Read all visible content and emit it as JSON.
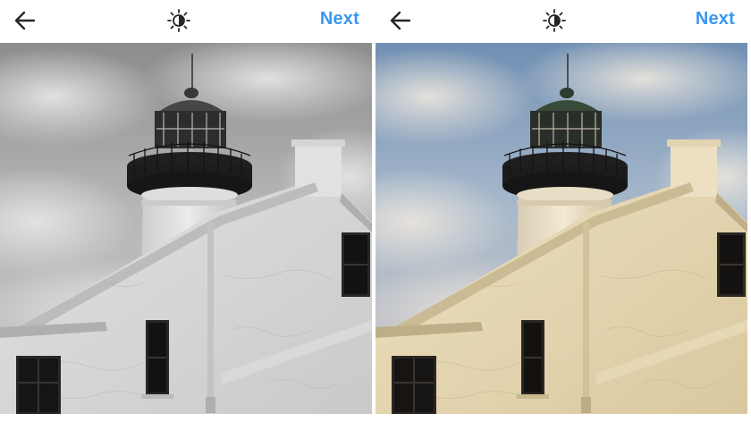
{
  "panels": [
    {
      "id": "left",
      "next_label": "Next",
      "filter": "black-and-white",
      "icons": {
        "back": "arrow-left-icon",
        "brightness": "brightness-icon"
      }
    },
    {
      "id": "right",
      "next_label": "Next",
      "filter": "warm-color",
      "icons": {
        "back": "arrow-left-icon",
        "brightness": "brightness-icon"
      }
    }
  ],
  "colors": {
    "accent": "#3897f0",
    "icon": "#262626",
    "background": "#ffffff"
  }
}
